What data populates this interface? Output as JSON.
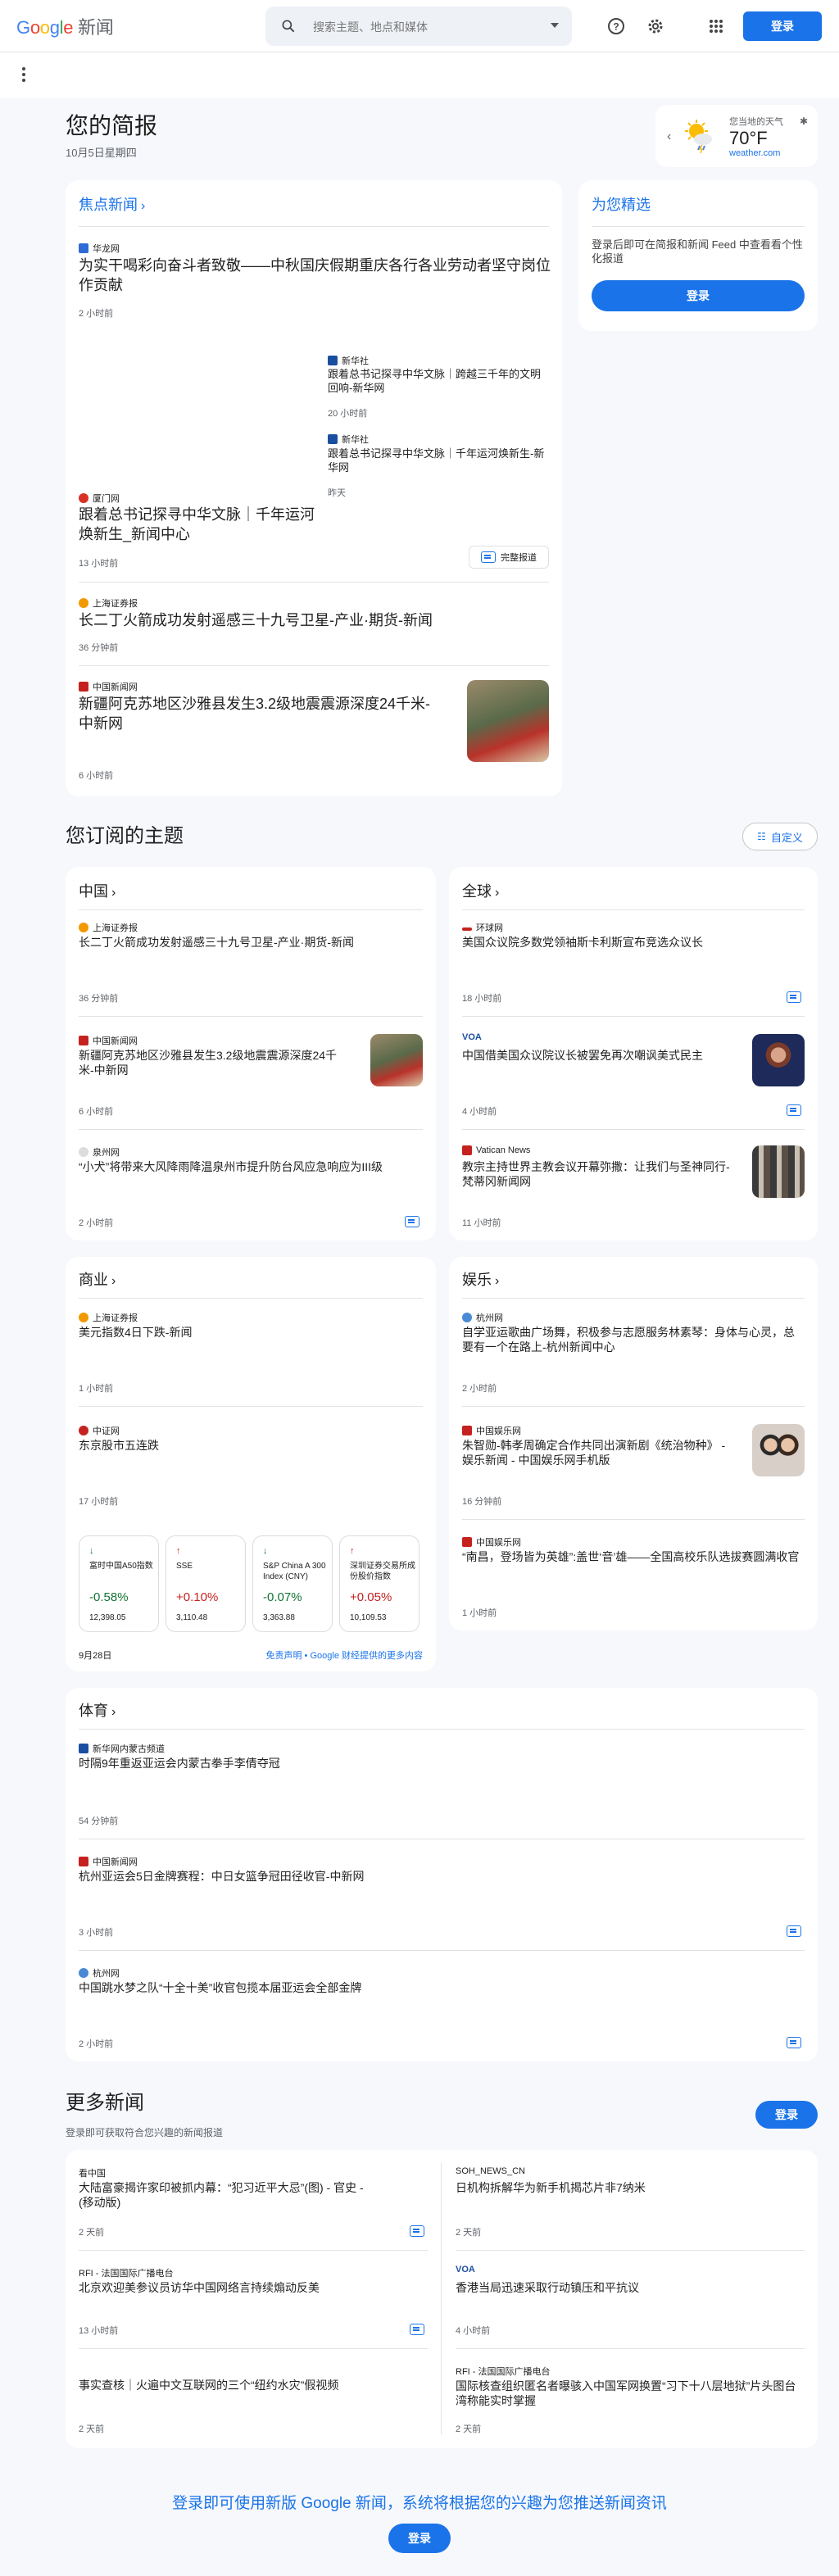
{
  "header": {
    "logo_google": [
      "G",
      "o",
      "o",
      "g",
      "l",
      "e"
    ],
    "logo_news": "新闻",
    "search_placeholder": "搜索主题、地点和媒体",
    "login_label": "登录"
  },
  "briefing": {
    "title": "您的简报",
    "date": "10月5日星期四"
  },
  "weather": {
    "label": "您当地的天气",
    "temp": "70°F",
    "source": "weather.com"
  },
  "top_stories": {
    "title": "焦点新闻",
    "items": [
      {
        "source": "华龙网",
        "headline": "为实干喝彩向奋斗者致敬——中秋国庆假期重庆各行各业劳动者坚守岗位作贡献",
        "time": "2 小时前",
        "fav_color": "#2f6bd6"
      },
      {
        "source": "厦门网",
        "headline": "跟着总书记探寻中华文脉｜千年运河焕新生_新闻中心",
        "time": "13 小时前",
        "fav_color": "#d93025"
      },
      {
        "source": "新华社",
        "headline": "跟着总书记探寻中华文脉｜跨越三千年的文明回响-新华网",
        "time": "20 小时前",
        "fav_color": "#1a4fa0"
      },
      {
        "source": "新华社",
        "headline": "跟着总书记探寻中华文脉｜千年运河焕新生-新华网",
        "time": "昨天",
        "fav_color": "#1a4fa0"
      },
      {
        "source": "上海证券报",
        "headline": "长二丁火箭成功发射遥感三十九号卫星-产业·期货-新闻",
        "time": "36 分钟前",
        "fav_color": "#f29900"
      },
      {
        "source": "中国新闻网",
        "headline": "新疆阿克苏地区沙雅县发生3.2级地震震源深度24千米-中新网",
        "time": "6 小时前",
        "fav_color": "#c5221f"
      }
    ],
    "full_coverage": "完整报道"
  },
  "picks": {
    "title": "为您精选",
    "desc": "登录后即可在简报和新闻 Feed 中查看看个性化报道",
    "login": "登录"
  },
  "topics": {
    "title": "您订阅的主题",
    "customize": "自定义",
    "china": {
      "title": "中国",
      "items": [
        {
          "source": "上海证券报",
          "headline": "长二丁火箭成功发射遥感三十九号卫星-产业·期货-新闻",
          "time": "36 分钟前"
        },
        {
          "source": "中国新闻网",
          "headline": "新疆阿克苏地区沙雅县发生3.2级地震震源深度24千米-中新网",
          "time": "6 小时前"
        },
        {
          "source": "泉州网",
          "headline": "“小犬”将带来大风降雨降温泉州市提升防台风应急响应为III级",
          "time": "2 小时前"
        }
      ]
    },
    "world": {
      "title": "全球",
      "items": [
        {
          "source": "环球网",
          "headline": "美国众议院多数党领袖斯卡利斯宣布竞选众议长",
          "time": "18 小时前"
        },
        {
          "source": "VOA",
          "headline": "中国借美国众议院议长被罢免再次嘲讽美式民主",
          "time": "4 小时前"
        },
        {
          "source": "Vatican News",
          "headline": "教宗主持世界主教会议开幕弥撒：让我们与圣神同行- 梵蒂冈新闻网",
          "time": "11 小时前"
        }
      ]
    },
    "business": {
      "title": "商业",
      "items": [
        {
          "source": "上海证券报",
          "headline": "美元指数4日下跌-新闻",
          "time": "1 小时前"
        },
        {
          "source": "中证网",
          "headline": "东京股市五连跌",
          "time": "17 小时前"
        }
      ],
      "stocks": [
        {
          "arrow": "↓",
          "name": "富时中国A50指数",
          "change": "-0.58%",
          "value": "12,398.05",
          "up": false
        },
        {
          "arrow": "↑",
          "name": "SSE",
          "change": "+0.10%",
          "value": "3,110.48",
          "up": true
        },
        {
          "arrow": "↓",
          "name": "S&P China A 300 Index (CNY)",
          "change": "-0.07%",
          "value": "3,363.88",
          "up": false
        },
        {
          "arrow": "↑",
          "name": "深圳证券交易所成份股价指数",
          "change": "+0.05%",
          "value": "10,109.53",
          "up": true
        }
      ],
      "stock_date": "9月28日",
      "disclaimer": "免责声明 • Google 财经提供的更多内容"
    },
    "entertainment": {
      "title": "娱乐",
      "items": [
        {
          "source": "杭州网",
          "headline": "自学亚运歌曲广场舞，积极参与志愿服务林素琴：身体与心灵，总要有一个在路上-杭州新闻中心",
          "time": "2 小时前"
        },
        {
          "source": "中国娱乐网",
          "headline": "朱智勋-韩孝周确定合作共同出演新剧《统治物种》 - 娱乐新闻 - 中国娱乐网手机版",
          "time": "16 分钟前"
        },
        {
          "source": "中国娱乐网",
          "headline": "“南昌，登场皆为英雄”:盖世‘音’雄——全国高校乐队选拔赛圆满收官",
          "time": "1 小时前"
        }
      ]
    },
    "sports": {
      "title": "体育",
      "items": [
        {
          "source": "新华网内蒙古频道",
          "headline": "时隔9年重返亚运会内蒙古拳手李倩夺冠",
          "time": "54 分钟前"
        },
        {
          "source": "中国新闻网",
          "headline": "杭州亚运会5日金牌赛程：中日女篮争冠田径收官-中新网",
          "time": "3 小时前"
        },
        {
          "source": "杭州网",
          "headline": "中国跳水梦之队“十全十美”收官包揽本届亚运会全部金牌",
          "time": "2 小时前"
        }
      ]
    }
  },
  "more": {
    "title": "更多新闻",
    "sub": "登录即可获取符合您兴趣的新闻报道",
    "login": "登录",
    "left": [
      {
        "source": "看中国",
        "headline": "大陆富豪揭许家印被抓内幕：“犯习近平大忌”(图) - 官史 -(移动版)",
        "time": "2 天前"
      },
      {
        "source": "RFI - 法国国际广播电台",
        "headline": "北京欢迎美参议员访华中国网络言持续煽动反美",
        "time": "13 小时前"
      },
      {
        "source": "",
        "headline": "事实查核｜火遍中文互联网的三个“纽约水灾”假视频",
        "time": "2 天前"
      }
    ],
    "right": [
      {
        "source": "SOH_NEWS_CN",
        "headline": "日机构拆解华为新手机揭芯片非7纳米",
        "time": "2 天前"
      },
      {
        "source": "VOA",
        "headline": "香港当局迅速采取行动镇压和平抗议",
        "time": "4 小时前"
      },
      {
        "source": "RFI - 法国国际广播电台",
        "headline": "国际核查组织匿名者曝骇入中国军网换置“习下十八层地狱”片头图台湾称能实时掌握",
        "time": "2 天前"
      }
    ]
  },
  "footer": {
    "cta": "登录即可使用新版 Google 新闻，系统将根据您的兴趣为您推送新闻资讯",
    "login": "登录"
  }
}
